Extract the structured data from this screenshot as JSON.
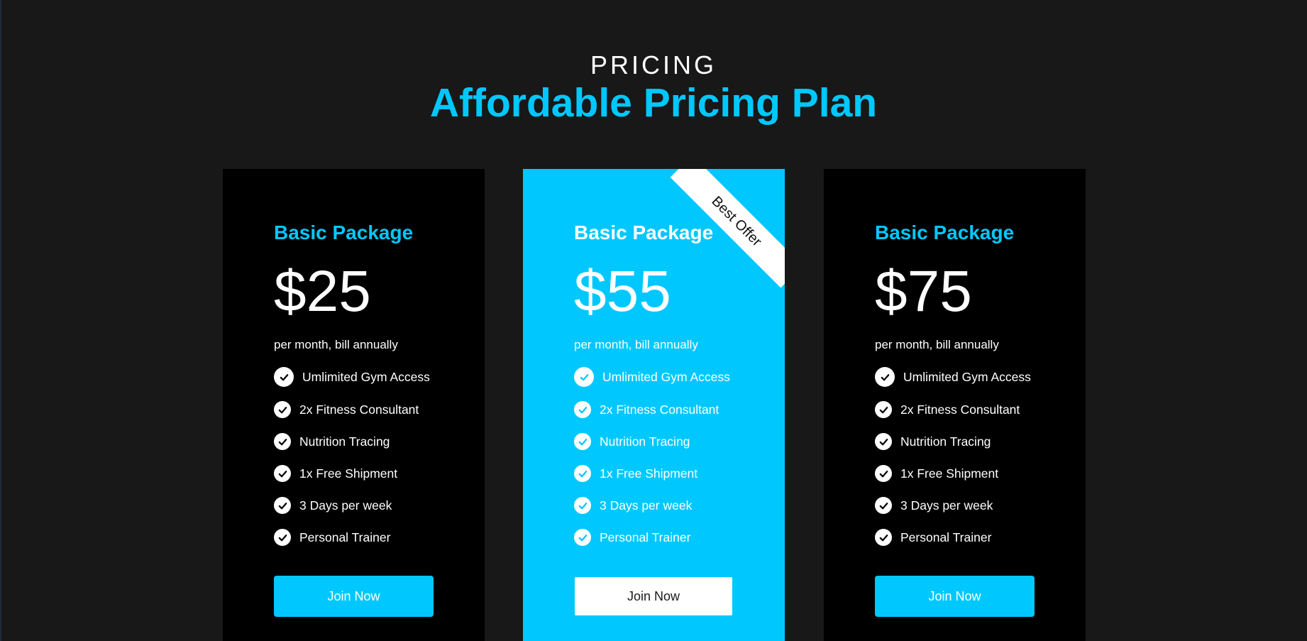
{
  "header": {
    "eyebrow": "PRICING",
    "headline": "Affordable Pricing Plan"
  },
  "colors": {
    "accent": "#00c8ff",
    "page_background": "#181818",
    "card_background": "#000000",
    "text": "#ffffff"
  },
  "plans": [
    {
      "name": "Basic Package",
      "price": "$25",
      "billing": "per month, bill annually",
      "features": [
        "Umlimited Gym Access",
        "2x Fitness Consultant",
        "Nutrition Tracing",
        "1x Free Shipment",
        "3 Days per week",
        "Personal Trainer"
      ],
      "button": "Join Now",
      "highlighted": false
    },
    {
      "name": "Basic Package",
      "price": "$55",
      "billing": "per month, bill annually",
      "features": [
        "Umlimited Gym Access",
        "2x Fitness Consultant",
        "Nutrition Tracing",
        "1x Free Shipment",
        "3 Days per week",
        "Personal Trainer"
      ],
      "button": "Join Now",
      "highlighted": true,
      "ribbon": "Best Offer"
    },
    {
      "name": "Basic Package",
      "price": "$75",
      "billing": "per month, bill annually",
      "features": [
        "Umlimited Gym Access",
        "2x Fitness Consultant",
        "Nutrition Tracing",
        "1x Free Shipment",
        "3 Days per week",
        "Personal Trainer"
      ],
      "button": "Join Now",
      "highlighted": false
    }
  ],
  "icons": {
    "feature": "check-circle-icon"
  }
}
